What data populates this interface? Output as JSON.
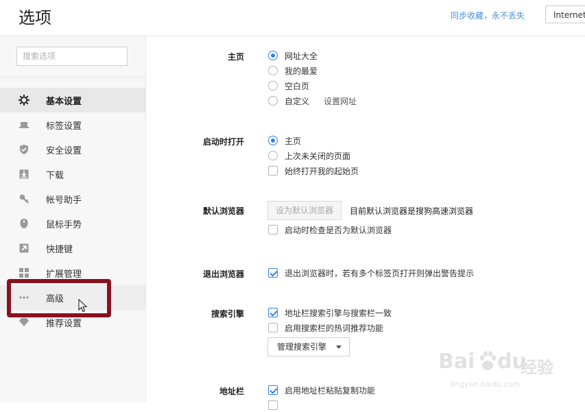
{
  "header": {
    "title": "选项",
    "sync_link": "同步收藏，永不丢失",
    "partial_button": "Internet"
  },
  "sidebar": {
    "search_placeholder": "搜索选项",
    "items": [
      {
        "label": "基本设置",
        "icon": "gear-icon",
        "active": true
      },
      {
        "label": "标签设置",
        "icon": "laptop-icon"
      },
      {
        "label": "安全设置",
        "icon": "shield-icon"
      },
      {
        "label": "下载",
        "icon": "download-icon"
      },
      {
        "label": "帐号助手",
        "icon": "key-icon"
      },
      {
        "label": "鼠标手势",
        "icon": "mouse-icon"
      },
      {
        "label": "快捷键",
        "icon": "arrow-shortcut-icon"
      },
      {
        "label": "扩展管理",
        "icon": "grid-icon"
      },
      {
        "label": "高级",
        "icon": "more-dots-icon",
        "hover": true
      },
      {
        "label": "推荐设置",
        "icon": "diamond-icon"
      }
    ]
  },
  "sections": {
    "homepage": {
      "label": "主页",
      "options": [
        "网址大全",
        "我的最爱",
        "空白页",
        "自定义"
      ],
      "selected": 0,
      "custom_link": "设置网址"
    },
    "startup": {
      "label": "启动时打开",
      "options": [
        "主页",
        "上次未关闭的页面"
      ],
      "selected": 0,
      "checkbox": {
        "label": "始终打开我的起始页",
        "checked": false
      }
    },
    "default_browser": {
      "label": "默认浏览器",
      "button": "设为默认浏览器",
      "status": "目前默认浏览器是搜狗高速浏览器",
      "checkbox": {
        "label": "启动时检查是否为默认浏览器",
        "checked": false
      }
    },
    "exit": {
      "label": "退出浏览器",
      "checkbox": {
        "label": "退出浏览器时，若有多个标签页打开则弹出警告提示",
        "checked": true
      }
    },
    "search": {
      "label": "搜索引擎",
      "checkboxes": [
        {
          "label": "地址栏搜索引擎与搜索栏一致",
          "checked": true
        },
        {
          "label": "启用搜索栏的热词推荐功能",
          "checked": false
        }
      ],
      "dropdown": "管理搜索引擎"
    },
    "addressbar": {
      "label": "地址栏",
      "checkbox": {
        "label": "启用地址栏粘贴复制功能",
        "checked": true
      }
    }
  },
  "watermark": {
    "brand": "Bai",
    "brand2": "du",
    "brand_cn": "经验",
    "url": "jingyan.baidu.com"
  },
  "colors": {
    "accent": "#2f80ed",
    "link": "#4a90d9",
    "highlight_box": "#8a1220"
  }
}
